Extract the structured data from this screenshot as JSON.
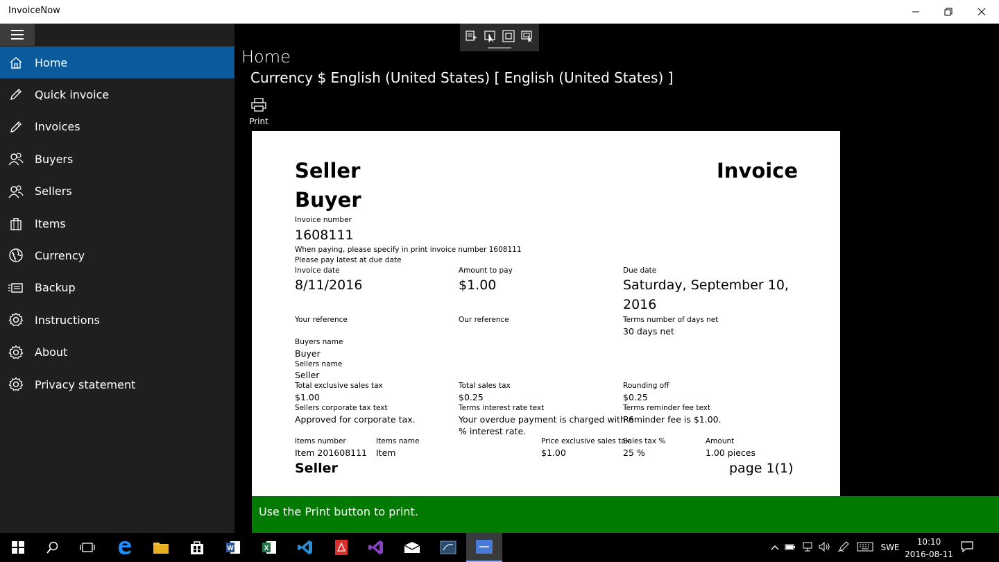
{
  "window": {
    "title": "InvoiceNow",
    "minimize_glyph": "—",
    "restore_glyph": "❐",
    "close_glyph": "✕"
  },
  "sidebar": {
    "menu_icon": "hamburger-icon",
    "items": [
      {
        "label": "Home",
        "icon": "home-icon",
        "active": true
      },
      {
        "label": "Quick invoice",
        "icon": "pencil-icon"
      },
      {
        "label": "Invoices",
        "icon": "pencil-icon"
      },
      {
        "label": "Buyers",
        "icon": "people-icon"
      },
      {
        "label": "Sellers",
        "icon": "people-icon"
      },
      {
        "label": "Items",
        "icon": "bag-icon"
      },
      {
        "label": "Currency",
        "icon": "globe-icon"
      },
      {
        "label": "Backup",
        "icon": "backup-icon"
      },
      {
        "label": "Instructions",
        "icon": "gear-icon"
      },
      {
        "label": "About",
        "icon": "gear-icon"
      },
      {
        "label": "Privacy statement",
        "icon": "gear-icon"
      }
    ],
    "accent": "#0a5a9c"
  },
  "header": {
    "title": "Home",
    "currency_line": "Currency $ English (United States) [ English (United States) ]"
  },
  "toolbar": {
    "print_label": "Print"
  },
  "invoice": {
    "seller_heading": "Seller",
    "buyer_heading": "Buyer",
    "invoice_heading": "Invoice",
    "invoice_number_label": "Invoice number",
    "invoice_number": "1608111",
    "pay_note": "When paying, please specify in print invoice number 1608111",
    "due_note": "Please pay latest at due date",
    "invoice_date_label": "Invoice date",
    "invoice_date": "8/11/2016",
    "amount_to_pay_label": "Amount to pay",
    "amount_to_pay": "$1.00",
    "due_date_label": "Due date",
    "due_date_line1": "Saturday, September 10,",
    "due_date_line2": "2016",
    "your_reference_label": "Your reference",
    "our_reference_label": "Our reference",
    "terms_days_label": "Terms number of days net",
    "terms_days": "30 days net",
    "buyers_name_label": "Buyers name",
    "buyers_name": "Buyer",
    "sellers_name_label": "Sellers name",
    "sellers_name": "Seller",
    "total_excl_label": "Total exclusive sales tax",
    "total_excl": "$1.00",
    "total_tax_label": "Total sales tax",
    "total_tax": "$0.25",
    "rounding_label": "Rounding off",
    "rounding": "$0.25",
    "corp_tax_label": "Sellers corporate tax text",
    "corp_tax": "Approved for corporate tax.",
    "interest_label": "Terms interest rate text",
    "interest_line1": "Your overdue payment is charged with 6",
    "interest_line2": "% interest rate.",
    "reminder_label": "Terms reminder fee text",
    "reminder": "Reminder fee is $1.00.",
    "columns": [
      "Items number",
      "Items name",
      "Price exclusive sales tax",
      "Sales tax %",
      "Amount"
    ],
    "row": [
      "Item 201608111",
      "Item",
      "$1.00",
      "25 %",
      "1.00 pieces"
    ],
    "footer_seller": "Seller",
    "footer_page": "page 1(1)"
  },
  "banner": {
    "text": "Use the Print button to print.",
    "color": "#007a00"
  },
  "taskbar": {
    "language": "SWE",
    "time": "10:10",
    "date": "2016-08-11"
  }
}
